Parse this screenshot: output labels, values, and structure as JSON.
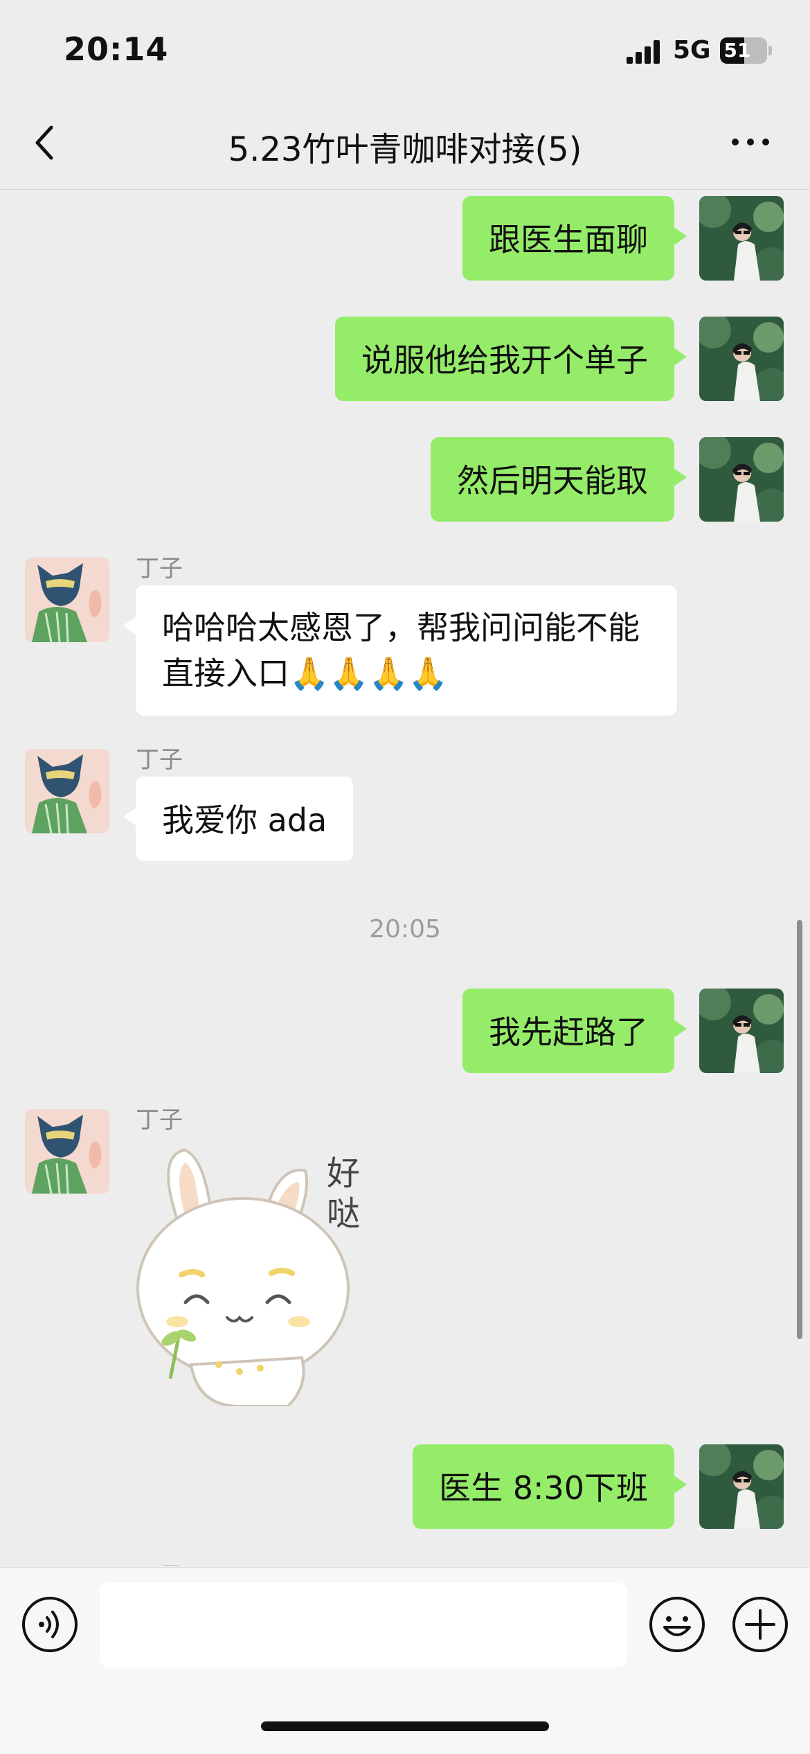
{
  "status_bar": {
    "time": "20:14",
    "network": "5G",
    "battery": "51",
    "battery_level": 0.51
  },
  "nav": {
    "title": "5.23竹叶青咖啡对接(5)",
    "back_icon": "chevron-left-icon",
    "more_icon": "more-dots-icon"
  },
  "messages": {
    "m1": {
      "text": "跟医生面聊"
    },
    "m2": {
      "text": "说服他给我开个单子"
    },
    "m3": {
      "text": "然后明天能取"
    },
    "m4": {
      "sender": "丁子",
      "text": "哈哈哈太感恩了，帮我问问能不能直接入口🙏🙏🙏🙏"
    },
    "m5": {
      "sender": "丁子",
      "text": "我爱你 ada"
    },
    "time_divider": "20:05",
    "m6": {
      "text": "我先赶路了"
    },
    "m7": {
      "sender": "丁子",
      "sticker_text": "好哒"
    },
    "m8": {
      "text": "医生 8:30下班"
    },
    "partial_sender": "丁子"
  },
  "input_bar": {
    "voice_icon": "voice-icon",
    "emoji_icon": "emoji-icon",
    "plus_icon": "plus-icon",
    "input_value": ""
  },
  "colors": {
    "outgoing_bubble": "#95ec69",
    "incoming_bubble": "#ffffff",
    "background": "#ededed"
  }
}
